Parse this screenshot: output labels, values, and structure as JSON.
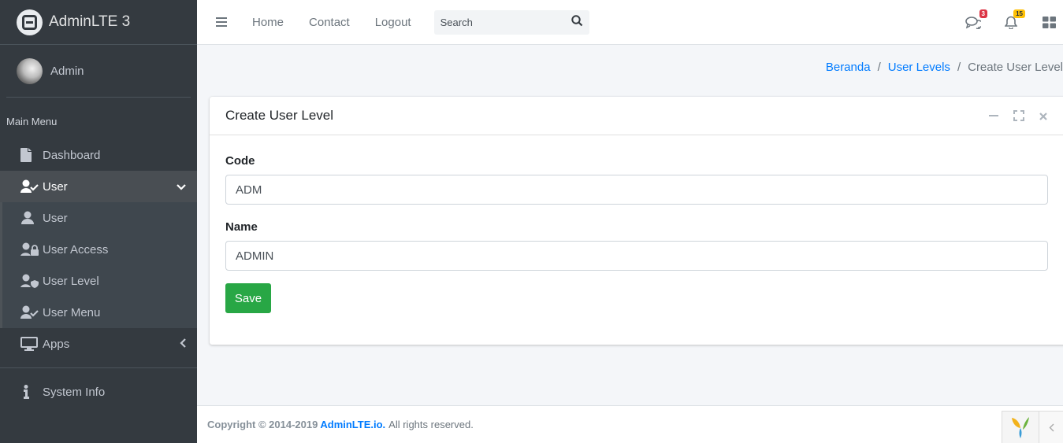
{
  "brand": {
    "name": "AdminLTE 3"
  },
  "user": {
    "name": "Admin"
  },
  "sidebar": {
    "header": "Main Menu",
    "items": [
      {
        "label": "Dashboard",
        "icon": "file-icon"
      },
      {
        "label": "User",
        "icon": "user-check-icon",
        "expanded": true
      },
      {
        "label": "Apps",
        "icon": "desktop-icon"
      },
      {
        "label": "System Info",
        "icon": "info-icon"
      }
    ],
    "subitems": [
      {
        "label": "User",
        "icon": "user-icon"
      },
      {
        "label": "User Access",
        "icon": "user-lock-icon"
      },
      {
        "label": "User Level",
        "icon": "user-shield-icon"
      },
      {
        "label": "User Menu",
        "icon": "user-check-icon"
      }
    ]
  },
  "navbar": {
    "links": [
      "Home",
      "Contact",
      "Logout"
    ],
    "search_placeholder": "Search",
    "messages_count": "3",
    "notifications_count": "15"
  },
  "breadcrumb": {
    "items": [
      "Beranda",
      "User Levels"
    ],
    "current": "Create User Level"
  },
  "card": {
    "title": "Create User Level",
    "fields": [
      {
        "label": "Code",
        "value": "ADM"
      },
      {
        "label": "Name",
        "value": "ADMIN"
      }
    ],
    "save_label": "Save"
  },
  "footer": {
    "copyright": "Copyright © 2014-2019",
    "link": "AdminLTE.io.",
    "rest": "All rights reserved."
  },
  "colors": {
    "sidebar_bg": "#343a40",
    "primary": "#007bff",
    "success": "#28a745",
    "danger": "#dc3545",
    "warning": "#ffc107"
  }
}
